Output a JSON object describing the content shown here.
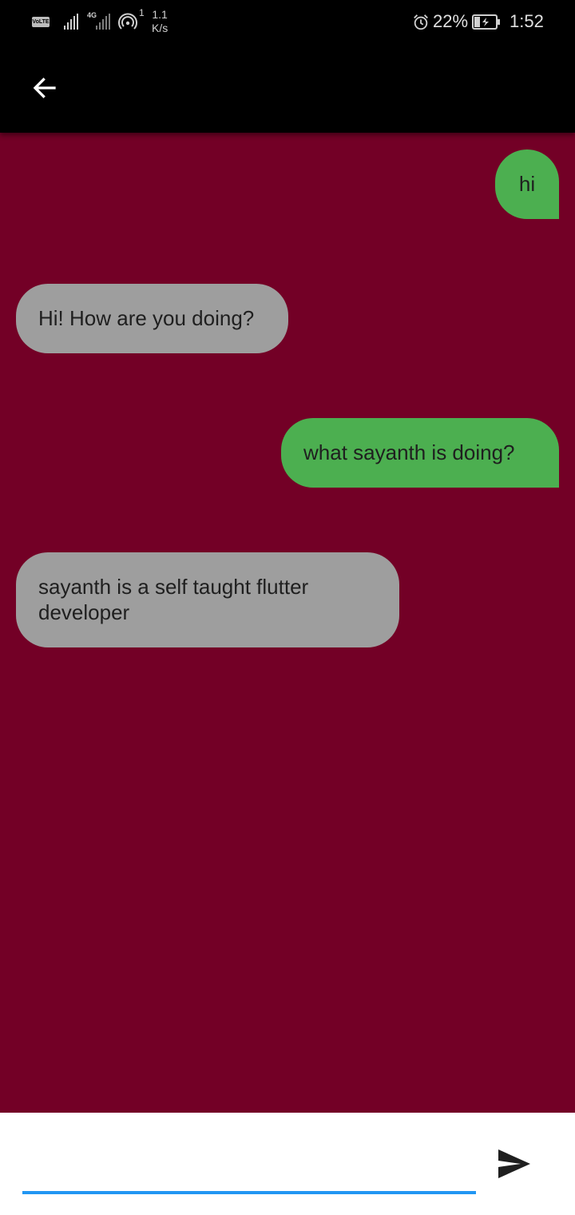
{
  "status_bar": {
    "volte_label": "VoLTE",
    "network_type": "4G",
    "hotspot_count": "1",
    "speed_value": "1.1",
    "speed_unit": "K/s",
    "battery_percent": "22%",
    "time": "1:52",
    "icons": [
      "volte-icon",
      "signal-icon",
      "hotspot-icon",
      "alarm-icon",
      "battery-charging-icon"
    ]
  },
  "app_bar": {
    "back_icon": "arrow-left-icon",
    "background": "#000000"
  },
  "chat": {
    "background": "#730026",
    "messages": [
      {
        "sender": "user",
        "text": "hi",
        "color": "#4caf50"
      },
      {
        "sender": "bot",
        "text": "Hi! How are you doing?",
        "color": "#9e9e9e"
      },
      {
        "sender": "user",
        "text": "what sayanth is doing?",
        "color": "#4caf50"
      },
      {
        "sender": "bot",
        "text": "sayanth is a self taught flutter developer",
        "color": "#9e9e9e"
      }
    ]
  },
  "composer": {
    "input_value": "",
    "input_placeholder": "",
    "underline_color": "#2196f3",
    "send_icon": "send-icon"
  }
}
